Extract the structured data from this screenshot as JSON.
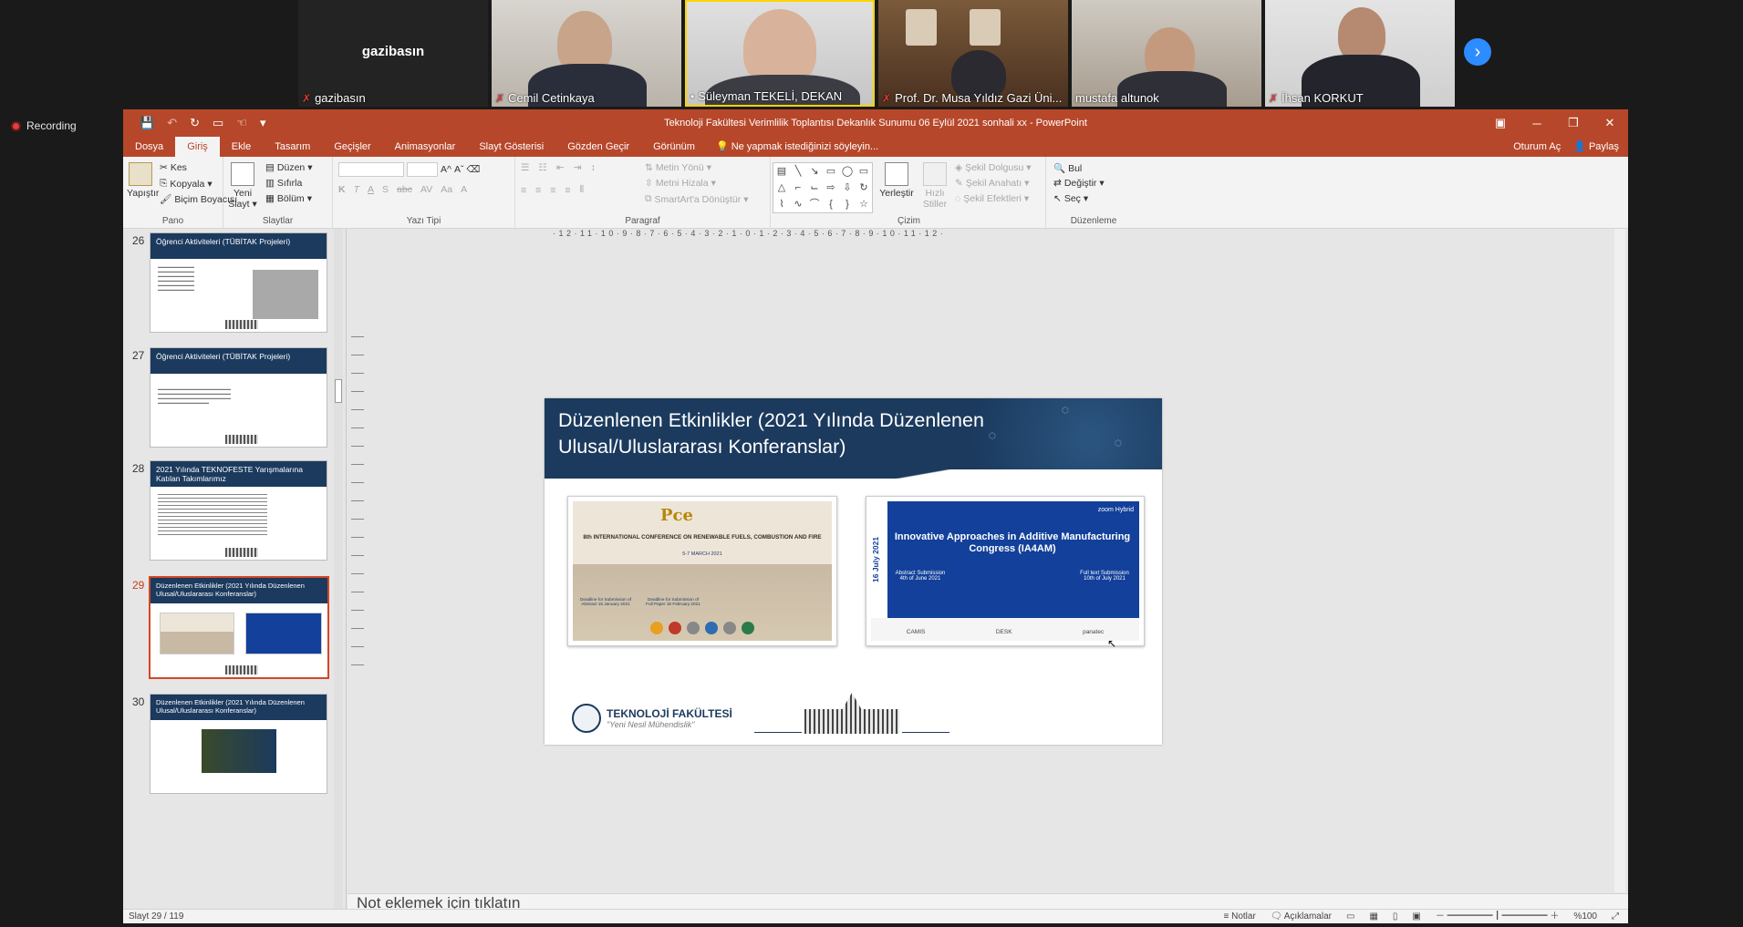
{
  "participants": [
    {
      "name": "gazibasın",
      "video": false
    },
    {
      "name": "Cemil Cetinkaya",
      "video": true
    },
    {
      "name": "Süleyman TEKELİ, DEKAN",
      "video": true
    },
    {
      "name": "Prof. Dr. Musa Yıldız Gazi Üni...",
      "video": true
    },
    {
      "name": "mustafa altunok",
      "video": true
    },
    {
      "name": "İhsan KORKUT",
      "video": true
    }
  ],
  "recording_label": "Recording",
  "ppt": {
    "window_title": "Teknoloji Fakültesi Verimlilik Toplantısı Dekanlık Sunumu 06 Eylül 2021 sonhali xx  -  PowerPoint",
    "tabs": [
      "Dosya",
      "Giriş",
      "Ekle",
      "Tasarım",
      "Geçişler",
      "Animasyonlar",
      "Slayt Gösterisi",
      "Gözden Geçir",
      "Görünüm"
    ],
    "active_tab": "Giriş",
    "tell_me": "Ne yapmak istediğinizi söyleyin...",
    "sign_in": "Oturum Aç",
    "share": "Paylaş",
    "ribbon": {
      "pano": {
        "label": "Pano",
        "paste": "Yapıştır",
        "cut": "Kes",
        "copy": "Kopyala",
        "format_painter": "Biçim Boyacısı"
      },
      "slaytlar": {
        "label": "Slaytlar",
        "new_slide": "Yeni Slayt",
        "layout": "Düzen",
        "reset": "Sıfırla",
        "section": "Bölüm"
      },
      "yazitipi": {
        "label": "Yazı Tipi"
      },
      "paragraf": {
        "label": "Paragraf",
        "text_direction": "Metin Yönü",
        "align_text": "Metni Hizala",
        "smartart": "SmartArt'a Dönüştür"
      },
      "cizim": {
        "label": "Çizim",
        "arrange": "Yerleştir",
        "quick_styles": "Hızlı Stiller",
        "shape_fill": "Şekil Dolgusu",
        "shape_outline": "Şekil Anahatı",
        "shape_effects": "Şekil Efektleri"
      },
      "duzenleme": {
        "label": "Düzenleme",
        "find": "Bul",
        "replace": "Değiştir",
        "select": "Seç"
      }
    },
    "thumbnails": [
      {
        "num": "26",
        "title": "Öğrenci Aktiviteleri (TÜBİTAK Projeleri)"
      },
      {
        "num": "27",
        "title": "Öğrenci Aktiviteleri (TÜBİTAK Projeleri)"
      },
      {
        "num": "28",
        "title": "2021 Yılında TEKNOFESTE Yarışmalarına Katılan Takımlarımız"
      },
      {
        "num": "29",
        "title": "Düzenlenen Etkinlikler (2021 Yılında Düzenlenen Ulusal/Uluslararası Konferanslar)"
      },
      {
        "num": "30",
        "title": "Düzenlenen Etkinlikler (2021 Yılında Düzenlenen Ulusal/Uluslararası Konferanslar)"
      }
    ],
    "slide": {
      "title": "Düzenlenen Etkinlikler (2021 Yılında Düzenlenen Ulusal/Uluslararası Konferanslar)",
      "poster1": {
        "logo": "Pce",
        "conference": "8th INTERNATIONAL CONFERENCE ON RENEWABLE FUELS, COMBUSTION AND FIRE",
        "dates": "5-7 MARCH 2021",
        "deadline1": "Deadline for Submission of Abstract 15 January 2021",
        "deadline2": "Deadline for Submission of Full Paper 15 February 2021"
      },
      "poster2": {
        "side_date": "16 July 2021",
        "title": "Innovative Approaches in Additive Manufacturing Congress (IA4AM)",
        "abstract": "Abstract Submission 4th of June 2021",
        "fulltext": "Full text Submission 10th of July 2021",
        "zoom": "zoom Hybrid",
        "sponsors": [
          "CAMIS",
          "DESK",
          "panatec"
        ]
      },
      "faculty": "TEKNOLOJİ FAKÜLTESİ",
      "motto": "\"Yeni Nesil Mühendislik\""
    },
    "notes_placeholder": "Not eklemek için tıklatın",
    "status": {
      "slide_count": "Slayt 29 / 119",
      "notes": "Notlar",
      "comments": "Açıklamalar",
      "zoom": "%100"
    }
  }
}
